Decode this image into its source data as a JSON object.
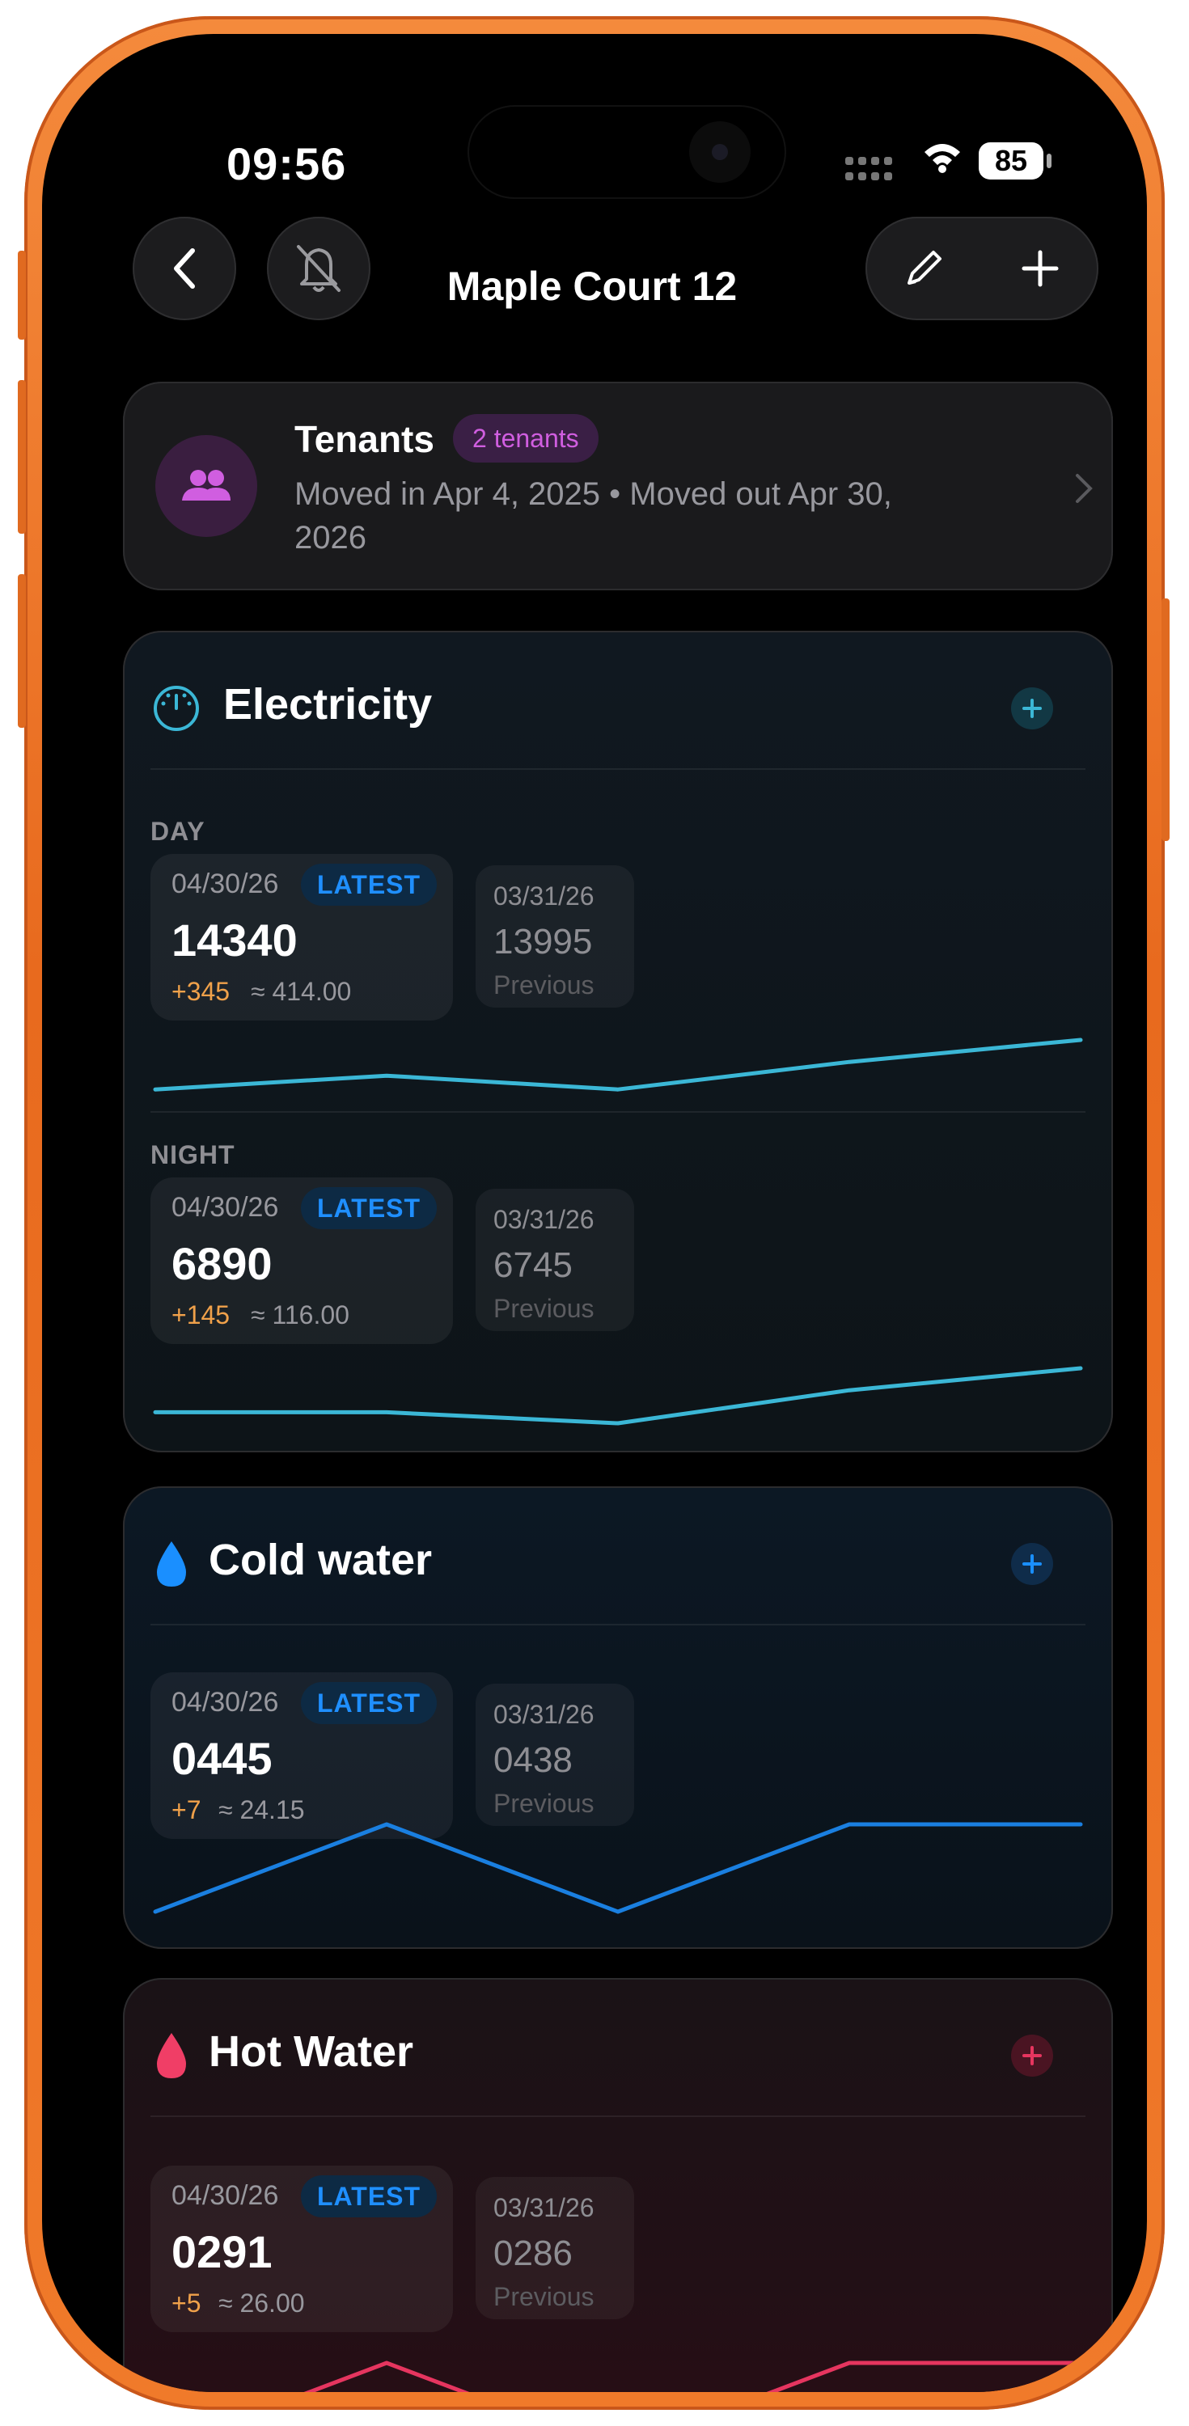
{
  "status": {
    "time": "09:56",
    "battery": "85"
  },
  "header": {
    "title": "Maple Court 12"
  },
  "tenants": {
    "title": "Tenants",
    "badge": "2 tenants",
    "subtitle": "Moved in Apr 4, 2025 • Moved out Apr 30, 2026"
  },
  "colors": {
    "electricity": "#3bb7d6",
    "cold_water": "#1a7fe0",
    "hot_water": "#e6355f",
    "tenant_accent": "#d05ee0",
    "delta": "#f0a14a"
  },
  "electricity": {
    "title": "Electricity",
    "icon": "gauge-icon",
    "day": {
      "label": "DAY",
      "latest": {
        "date": "04/30/26",
        "badge": "LATEST",
        "value": "14340",
        "delta": "+345",
        "approx": "≈ 414.00"
      },
      "previous": {
        "date": "03/31/26",
        "value": "13995",
        "label": "Previous"
      },
      "trend": [
        0.1,
        0.35,
        0.1,
        0.6,
        1.0
      ]
    },
    "night": {
      "label": "NIGHT",
      "latest": {
        "date": "04/30/26",
        "badge": "LATEST",
        "value": "6890",
        "delta": "+145",
        "approx": "≈ 116.00"
      },
      "previous": {
        "date": "03/31/26",
        "value": "6745",
        "label": "Previous"
      },
      "trend": [
        0.2,
        0.2,
        0.0,
        0.6,
        1.0
      ]
    }
  },
  "cold_water": {
    "title": "Cold water",
    "icon": "water-drop-icon",
    "latest": {
      "date": "04/30/26",
      "badge": "LATEST",
      "value": "0445",
      "delta": "+7",
      "approx": "≈ 24.15"
    },
    "previous": {
      "date": "03/31/26",
      "value": "0438",
      "label": "Previous"
    },
    "trend": [
      0.0,
      1.0,
      0.0,
      1.0,
      1.0
    ]
  },
  "hot_water": {
    "title": "Hot Water",
    "icon": "water-drop-icon",
    "latest": {
      "date": "04/30/26",
      "badge": "LATEST",
      "value": "0291",
      "delta": "+5",
      "approx": "≈ 26.00"
    },
    "previous": {
      "date": "03/31/26",
      "value": "0286",
      "label": "Previous"
    },
    "trend": [
      0.0,
      1.0,
      0.0,
      1.0,
      1.0
    ]
  }
}
